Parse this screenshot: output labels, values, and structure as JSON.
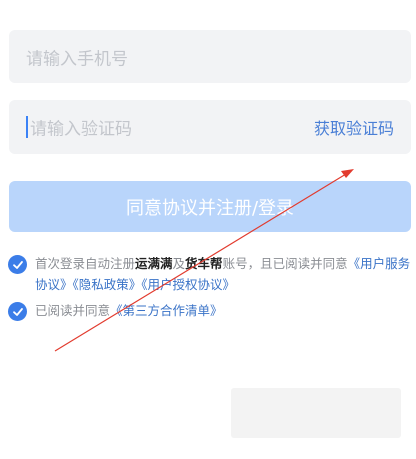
{
  "phone": {
    "placeholder": "请输入手机号"
  },
  "code": {
    "placeholder": "请输入验证码",
    "get_code_label": "获取验证码"
  },
  "submit_label": "同意协议并注册/登录",
  "agreement1": {
    "prefix": "首次登录自动注册",
    "brand1": "运满满",
    "mid1": "及",
    "brand2": "货车帮",
    "mid2": "账号，且已阅读并同意",
    "link_service": "《用户服务协议》",
    "link_privacy": "《隐私政策》",
    "link_auth": "《用户授权协议》"
  },
  "agreement2": {
    "prefix": "已阅读并同意",
    "link_third": "《第三方合作清单》"
  },
  "colors": {
    "accent": "#3b7de8",
    "button_disabled": "#b9d5fb",
    "field_bg": "#f2f3f5",
    "arrow": "#e23b2e"
  },
  "icons": {
    "check": "check-circle-icon",
    "arrow": "annotation-arrow"
  }
}
